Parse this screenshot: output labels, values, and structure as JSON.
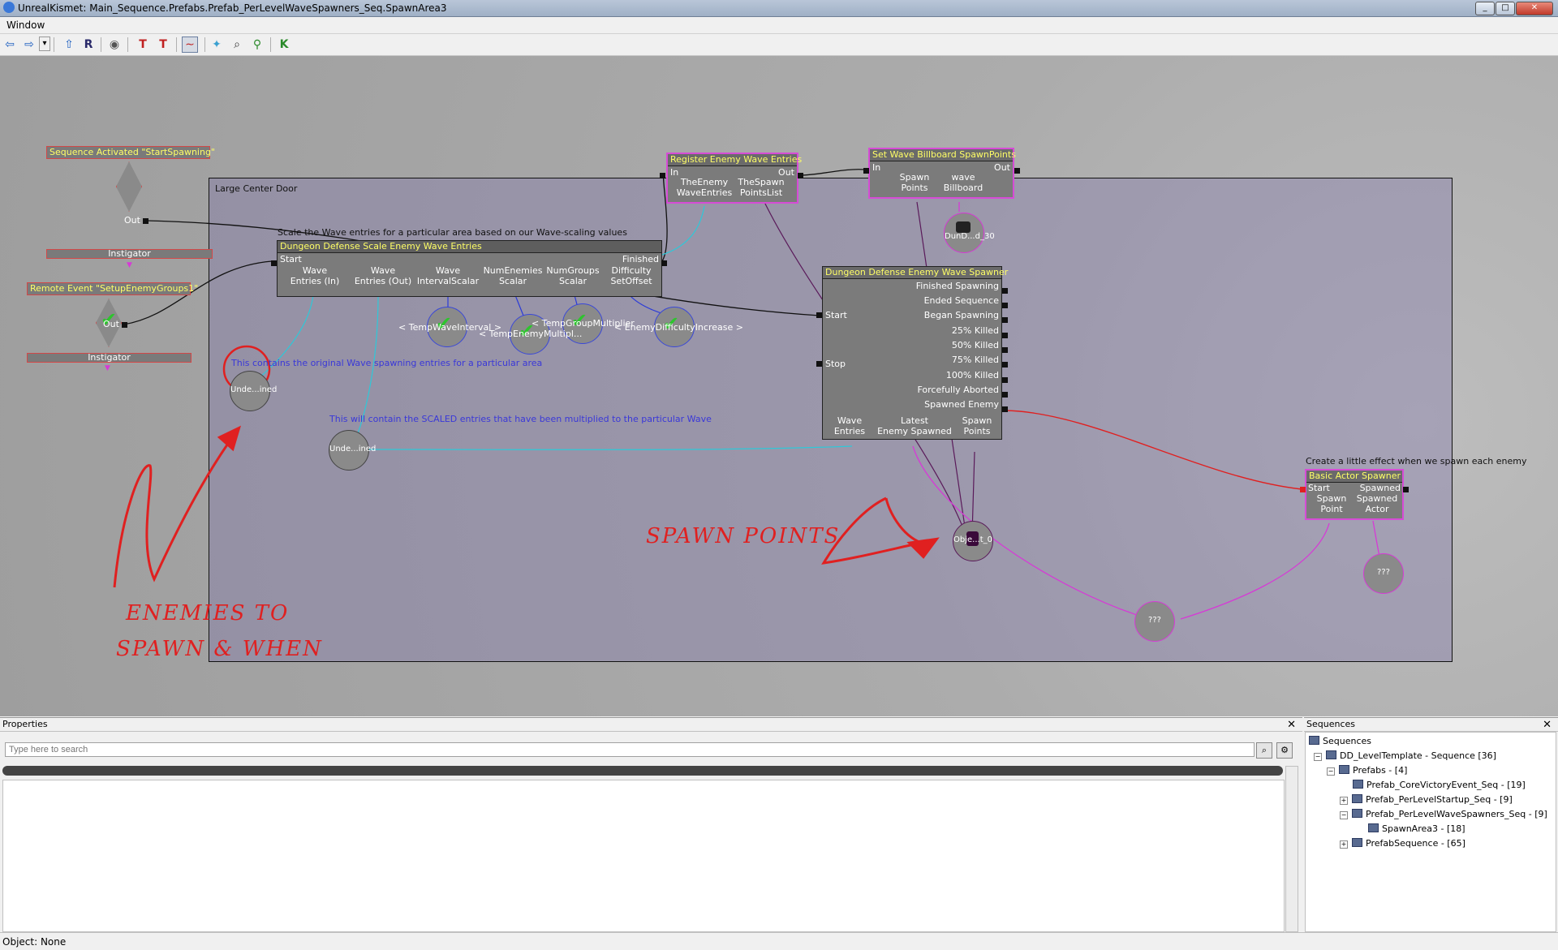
{
  "window": {
    "title": "UnrealKismet: Main_Sequence.Prefabs.Prefab_PerLevelWaveSpawners_Seq.SpawnArea3",
    "minimize": "0",
    "maximize": "1",
    "close": "r"
  },
  "menu": {
    "window": "Window"
  },
  "toolbar": [
    {
      "name": "back-arrow-icon",
      "glyph": "⇦"
    },
    {
      "name": "forward-arrow-icon",
      "glyph": "⇨"
    },
    {
      "name": "history-dropdown-icon",
      "glyph": "▾"
    },
    {
      "name": "parent-sequence-icon",
      "glyph": "⇧"
    },
    {
      "name": "rename-sequence-icon",
      "glyph": "R"
    },
    {
      "name": "view-eye-icon",
      "glyph": "◉"
    },
    {
      "name": "search-sequence-icon",
      "glyph": "T"
    },
    {
      "name": "search-sequence-objects-icon",
      "glyph": "T"
    },
    {
      "name": "curve-view-icon",
      "glyph": "∼"
    },
    {
      "name": "lightbulb-icon",
      "glyph": "✦"
    },
    {
      "name": "zoom-icon",
      "glyph": "⌕"
    },
    {
      "name": "open-class-icon",
      "glyph": "⚲"
    },
    {
      "name": "kismet-k-icon",
      "glyph": "K"
    }
  ],
  "graph": {
    "comment_large_door": "Large Center Door",
    "comment_scale": "Scale the Wave entries for a particular area based on our Wave-scaling values",
    "comment_effect": "Create a little effect when we spawn each enemy",
    "note_original": "This contains the original Wave spawning entries for a particular area",
    "note_scaled": "This will contain the SCALED entries that have been multiplied to the particular Wave",
    "seq_activated": {
      "title": "Sequence Activated \"StartSpawning\"",
      "out": "Out",
      "instigator": "Instigator"
    },
    "remote_event": {
      "title": "Remote Event \"SetupEnemyGroups1\"",
      "out": "Out",
      "instigator": "Instigator"
    },
    "scale_node": {
      "title": "Dungeon Defense Scale Enemy Wave Entries",
      "start": "Start",
      "finished": "Finished",
      "vars": [
        {
          "l1": "Wave",
          "l2": "Entries (In)"
        },
        {
          "l1": "Wave",
          "l2": "Entries (Out)"
        },
        {
          "l1": "Wave",
          "l2": "IntervalScalar"
        },
        {
          "l1": "NumEnemies",
          "l2": "Scalar"
        },
        {
          "l1": "NumGroups",
          "l2": "Scalar"
        },
        {
          "l1": "Difficulty",
          "l2": "SetOffset"
        }
      ]
    },
    "scale_vars": [
      {
        "label": "< TempWaveInterval >"
      },
      {
        "label": "< TempEnemyMultipl..."
      },
      {
        "label": "< TempGroupMultiplier"
      },
      {
        "label": "< EnemyDifficultyIncrease >"
      }
    ],
    "register_node": {
      "title": "Register Enemy Wave Entries",
      "in": "In",
      "out": "Out",
      "var1_l1": "TheEnemy",
      "var1_l2": "WaveEntries",
      "var2_l1": "TheSpawn",
      "var2_l2": "PointsList"
    },
    "billboard_node": {
      "title": "Set Wave Billboard SpawnPoints",
      "in": "In",
      "out": "Out",
      "var1_l1": "Spawn",
      "var1_l2": "Points",
      "var2_l1": "wave",
      "var2_l2": "Billboard"
    },
    "spawner_node": {
      "title": "Dungeon Defense Enemy Wave Spawner",
      "start": "Start",
      "stop": "Stop",
      "outputs": [
        "Finished Spawning",
        "Ended Sequence",
        "Began Spawning",
        "25% Killed",
        "50% Killed",
        "75% Killed",
        "100% Killed",
        "Forcefully Aborted",
        "Spawned Enemy"
      ],
      "vars": [
        {
          "l1": "Wave",
          "l2": "Entries"
        },
        {
          "l1": "Latest",
          "l2": "Enemy Spawned"
        },
        {
          "l1": "Spawn",
          "l2": "Points"
        }
      ]
    },
    "actor_spawner_node": {
      "title": "Basic Actor Spawner",
      "start": "Start",
      "spawned": "Spawned",
      "var1_l1": "Spawn",
      "var1_l2": "Point",
      "var2_l1": "Spawned",
      "var2_l2": "Actor"
    },
    "var_undefined_1": "Unde...ined",
    "var_undefined_2": "Unde...ined",
    "var_dund": "DunD...d_30",
    "var_object": "Obje...t_0",
    "var_unknown_1": "???",
    "var_unknown_2": "???",
    "handwriting": {
      "spawn_points": "SPAWN POINTS",
      "enemies_line1": "ENEMIES TO",
      "enemies_line2": "SPAWN & WHEN"
    }
  },
  "properties": {
    "title": "Properties",
    "close": "✕",
    "search_placeholder": "Type here to search"
  },
  "sequences": {
    "title": "Sequences",
    "close": "✕",
    "tree": [
      {
        "label": "Sequences",
        "expander": ""
      },
      {
        "label": "DD_LevelTemplate - Sequence [36]",
        "expander": "−"
      },
      {
        "label": "Prefabs - [4]",
        "expander": "−"
      },
      {
        "label": "Prefab_CoreVictoryEvent_Seq - [19]",
        "expander": ""
      },
      {
        "label": "Prefab_PerLevelStartup_Seq - [9]",
        "expander": "+"
      },
      {
        "label": "Prefab_PerLevelWaveSpawners_Seq - [9]",
        "expander": "−"
      },
      {
        "label": "SpawnArea3 - [18]",
        "expander": ""
      },
      {
        "label": "PrefabSequence - [65]",
        "expander": "+"
      }
    ]
  },
  "status": {
    "text": "Object: None"
  }
}
